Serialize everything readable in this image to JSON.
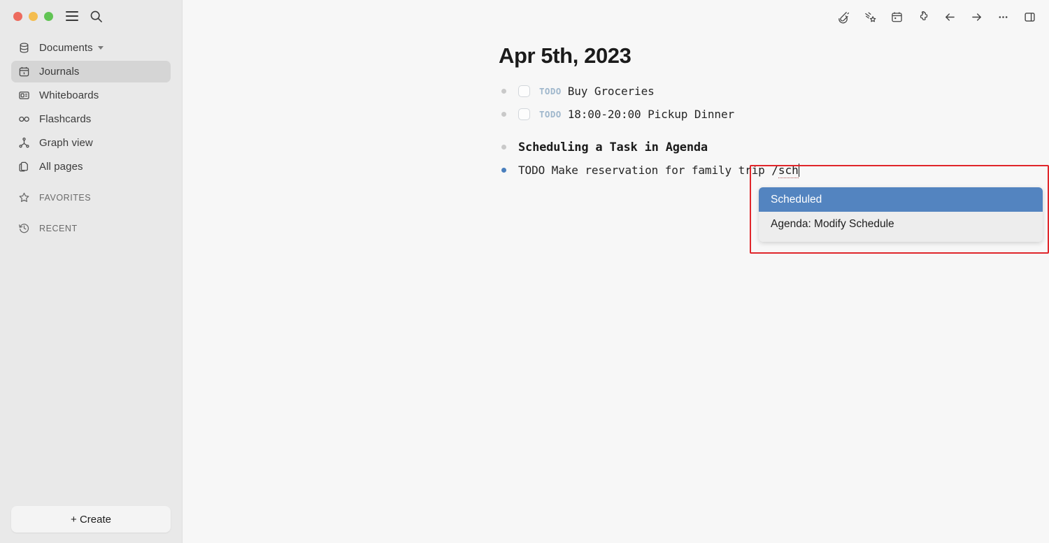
{
  "window": {
    "traffic_lights": [
      "close",
      "minimize",
      "maximize"
    ],
    "colors": {
      "close": "#ed6b5e",
      "minimize": "#f4bd4f",
      "maximize": "#61c454",
      "sidebar_bg": "#e9e9e9",
      "main_bg": "#f7f7f7",
      "accent_blue": "#5384c0",
      "active_bullet": "#4a7fbd",
      "todo_tag": "#9fb7cc",
      "annotation_red": "#e0262b"
    }
  },
  "sidebar": {
    "menu_icon": "hamburger-icon",
    "search_icon": "search-icon",
    "items": [
      {
        "label": "Documents",
        "icon": "database-icon",
        "active": false,
        "has_caret": true
      },
      {
        "label": "Journals",
        "icon": "calendar-icon",
        "active": true,
        "has_caret": false
      },
      {
        "label": "Whiteboards",
        "icon": "whiteboard-icon",
        "active": false,
        "has_caret": false
      },
      {
        "label": "Flashcards",
        "icon": "infinity-icon",
        "active": false,
        "has_caret": false
      },
      {
        "label": "Graph view",
        "icon": "graph-icon",
        "active": false,
        "has_caret": false
      },
      {
        "label": "All pages",
        "icon": "pages-icon",
        "active": false,
        "has_caret": false
      }
    ],
    "sections": [
      {
        "label": "FAVORITES",
        "icon": "star-icon"
      },
      {
        "label": "RECENT",
        "icon": "history-icon"
      }
    ],
    "create_button": "+ Create"
  },
  "toolbar": {
    "icons": [
      "edit-pencil-icon",
      "shooting-star-icon",
      "calendar-icon",
      "puzzle-plugin-icon",
      "arrow-left-icon",
      "arrow-right-icon",
      "more-dots-icon",
      "right-sidebar-toggle-icon"
    ]
  },
  "document": {
    "title": "Apr 5th, 2023",
    "blocks": [
      {
        "type": "todo",
        "tag": "TODO",
        "text": "Buy Groceries",
        "checked": false,
        "bullet": "dim"
      },
      {
        "type": "todo",
        "tag": "TODO",
        "text": "18:00-20:00 Pickup Dinner",
        "checked": false,
        "bullet": "dim"
      },
      {
        "type": "heading",
        "text": "Scheduling a Task in Agenda",
        "bullet": "dim"
      },
      {
        "type": "editing",
        "text": "TODO Make reservation for family trip ",
        "bullet": "active",
        "typed": "/sch"
      }
    ]
  },
  "slash_menu": {
    "query": "/sch",
    "options": [
      {
        "label": "Scheduled",
        "selected": true
      },
      {
        "label": "Agenda: Modify Schedule",
        "selected": false
      }
    ]
  }
}
